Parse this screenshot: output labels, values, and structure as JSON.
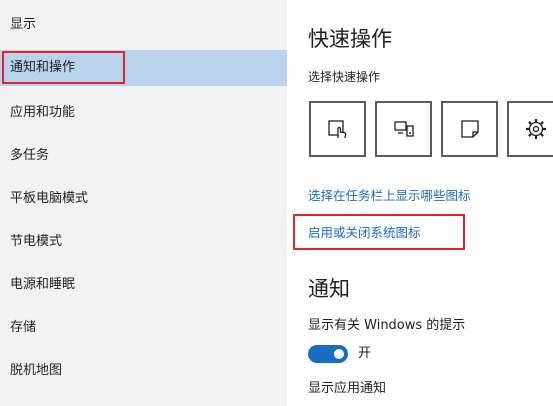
{
  "sidebar": {
    "items": [
      {
        "label": "显示"
      },
      {
        "label": "通知和操作"
      },
      {
        "label": "应用和功能"
      },
      {
        "label": "多任务"
      },
      {
        "label": "平板电脑模式"
      },
      {
        "label": "节电模式"
      },
      {
        "label": "电源和睡眠"
      },
      {
        "label": "存储"
      },
      {
        "label": "脱机地图"
      }
    ],
    "selected": "通知和操作"
  },
  "main": {
    "quick_actions_title": "快速操作",
    "quick_actions_subtitle": "选择快速操作",
    "tiles": [
      {
        "icon": "tablet-mode-icon"
      },
      {
        "icon": "project-display-icon"
      },
      {
        "icon": "note-icon"
      },
      {
        "icon": "settings-gear-icon"
      }
    ],
    "link_taskbar_icons": "选择在任务栏上显示哪些图标",
    "link_system_icons": "启用或关闭系统图标",
    "notifications_title": "通知",
    "windows_tips_label": "显示有关 Windows 的提示",
    "windows_tips_toggle": "开",
    "windows_tips_on": true,
    "app_notifications_label": "显示应用通知"
  },
  "colors": {
    "sidebar_bg": "#f2f2f2",
    "selected_bg": "#b9d3ed",
    "highlight_red": "#e0242c",
    "link_blue": "#1a6cc0",
    "toggle_on": "#1a6cc0"
  }
}
